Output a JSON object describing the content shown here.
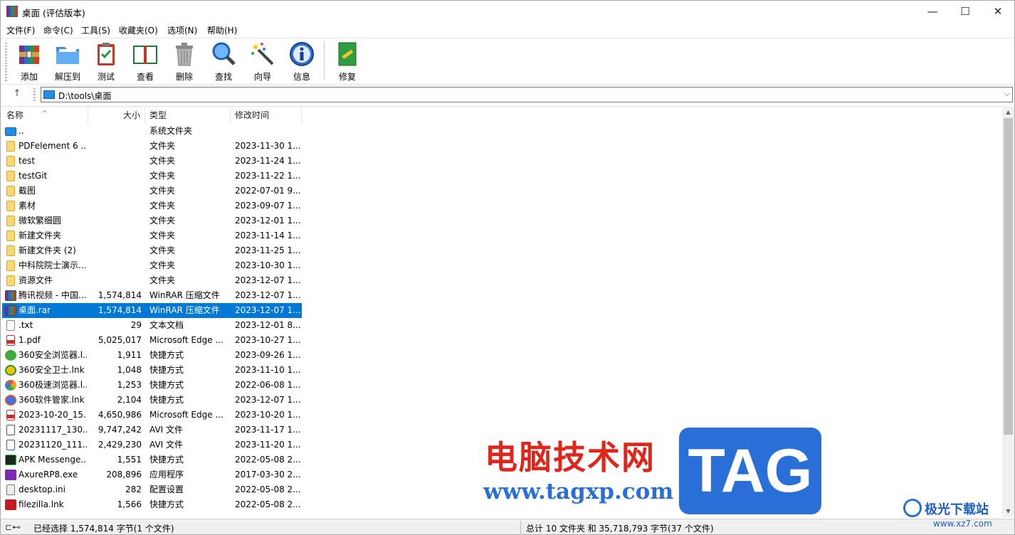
{
  "window": {
    "title": "桌面 (评估版本)",
    "controls": {
      "minimize": "—",
      "maximize": "☐",
      "close": "✕"
    }
  },
  "menu": [
    "文件(F)",
    "命令(C)",
    "工具(S)",
    "收藏夹(O)",
    "选项(N)",
    "帮助(H)"
  ],
  "toolbar": {
    "add": "添加",
    "extract": "解压到",
    "test": "测试",
    "view": "查看",
    "delete": "删除",
    "find": "查找",
    "wizard": "向导",
    "info": "信息",
    "repair": "修复"
  },
  "address": {
    "path": "D:\\tools\\桌面",
    "up": "↑",
    "drop": "⌵"
  },
  "columns": {
    "name": "名称",
    "size": "大小",
    "type": "类型",
    "modified": "修改时间",
    "sort": "^"
  },
  "files": [
    {
      "name": "..",
      "size": "",
      "type": "系统文件夹",
      "date": "",
      "icon": "up"
    },
    {
      "name": "PDFelement 6 ...",
      "size": "",
      "type": "文件夹",
      "date": "2023-11-30 1...",
      "icon": "folder"
    },
    {
      "name": "test",
      "size": "",
      "type": "文件夹",
      "date": "2023-11-24 1...",
      "icon": "folder"
    },
    {
      "name": "testGit",
      "size": "",
      "type": "文件夹",
      "date": "2023-11-22 1...",
      "icon": "folder"
    },
    {
      "name": "截图",
      "size": "",
      "type": "文件夹",
      "date": "2022-07-01 9...",
      "icon": "folder"
    },
    {
      "name": "素材",
      "size": "",
      "type": "文件夹",
      "date": "2023-09-07 1...",
      "icon": "folder"
    },
    {
      "name": "微软繁细圆",
      "size": "",
      "type": "文件夹",
      "date": "2023-12-01 1...",
      "icon": "folder"
    },
    {
      "name": "新建文件夹",
      "size": "",
      "type": "文件夹",
      "date": "2023-11-14 1...",
      "icon": "folder"
    },
    {
      "name": "新建文件夹 (2)",
      "size": "",
      "type": "文件夹",
      "date": "2023-11-25 1...",
      "icon": "folder"
    },
    {
      "name": "中科院院士演示...",
      "size": "",
      "type": "文件夹",
      "date": "2023-10-30 1...",
      "icon": "folder"
    },
    {
      "name": "资源文件",
      "size": "",
      "type": "文件夹",
      "date": "2023-12-07 1...",
      "icon": "folder"
    },
    {
      "name": "腾讯视频 - 中国...",
      "size": "1,574,814",
      "type": "WinRAR 压缩文件",
      "date": "2023-12-07 1...",
      "icon": "rar"
    },
    {
      "name": "桌面.rar",
      "size": "1,574,814",
      "type": "WinRAR 压缩文件",
      "date": "2023-12-07 1...",
      "icon": "rar",
      "selected": true
    },
    {
      "name": ".txt",
      "size": "29",
      "type": "文本文档",
      "date": "2023-12-01 8...",
      "icon": "txt"
    },
    {
      "name": "1.pdf",
      "size": "5,025,017",
      "type": "Microsoft Edge ...",
      "date": "2023-10-27 1...",
      "icon": "pdf"
    },
    {
      "name": "360安全浏览器.l...",
      "size": "1,911",
      "type": "快捷方式",
      "date": "2023-09-26 1...",
      "icon": "e360"
    },
    {
      "name": "360安全卫士.lnk",
      "size": "1,048",
      "type": "快捷方式",
      "date": "2023-11-10 1...",
      "icon": "w360"
    },
    {
      "name": "360极速浏览器.l...",
      "size": "1,253",
      "type": "快捷方式",
      "date": "2022-06-08 1...",
      "icon": "j360"
    },
    {
      "name": "360软件管家.lnk",
      "size": "2,104",
      "type": "快捷方式",
      "date": "2023-12-07 1...",
      "icon": "m360"
    },
    {
      "name": "2023-10-20_15...",
      "size": "4,650,986",
      "type": "Microsoft Edge ...",
      "date": "2023-10-20 1...",
      "icon": "pdf"
    },
    {
      "name": "20231117_130...",
      "size": "9,747,242",
      "type": "AVI 文件",
      "date": "2023-11-17 1...",
      "icon": "avi"
    },
    {
      "name": "20231120_111...",
      "size": "2,429,230",
      "type": "AVI 文件",
      "date": "2023-11-20 1...",
      "icon": "avi"
    },
    {
      "name": "APK Messenge...",
      "size": "1,551",
      "type": "快捷方式",
      "date": "2022-05-08 2...",
      "icon": "apk"
    },
    {
      "name": "AxureRP8.exe",
      "size": "208,896",
      "type": "应用程序",
      "date": "2017-03-30 2...",
      "icon": "axure"
    },
    {
      "name": "desktop.ini",
      "size": "282",
      "type": "配置设置",
      "date": "2022-05-08 2...",
      "icon": "ini"
    },
    {
      "name": "filezilla.lnk",
      "size": "1,566",
      "type": "快捷方式",
      "date": "2022-05-08 2...",
      "icon": "fz"
    }
  ],
  "status": {
    "icons": "⊏⊷",
    "left": "已经选择 1,574,814 字节(1 个文件)",
    "right": "总计 10 文件夹 和 35,718,793 字节(37 个文件)"
  },
  "watermark": {
    "cn": "电脑技术网",
    "url": "www.tagxp.com",
    "tag": "TAG",
    "site": "极光下载站",
    "site_url": "www.xz7.com"
  }
}
